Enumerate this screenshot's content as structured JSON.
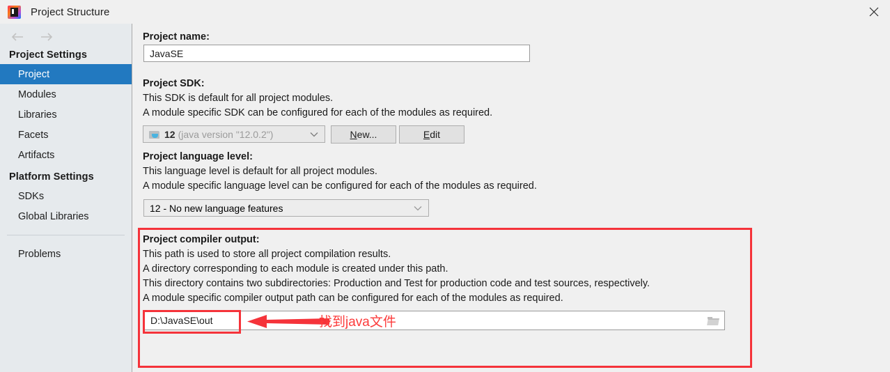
{
  "window": {
    "title": "Project Structure",
    "icon": "intellij-idea-logo",
    "close_label": "✕"
  },
  "sidebar": {
    "nav_back_icon": "arrow-left-icon",
    "nav_forward_icon": "arrow-right-icon",
    "groups": [
      {
        "header": "Project Settings",
        "items": [
          {
            "label": "Project",
            "selected": true
          },
          {
            "label": "Modules",
            "selected": false
          },
          {
            "label": "Libraries",
            "selected": false
          },
          {
            "label": "Facets",
            "selected": false
          },
          {
            "label": "Artifacts",
            "selected": false
          }
        ]
      },
      {
        "header": "Platform Settings",
        "items": [
          {
            "label": "SDKs",
            "selected": false
          },
          {
            "label": "Global Libraries",
            "selected": false
          }
        ]
      }
    ],
    "problems_label": "Problems"
  },
  "main": {
    "project_name": {
      "label": "Project name:",
      "value": "JavaSE"
    },
    "project_sdk": {
      "label": "Project SDK:",
      "desc_line1": "This SDK is default for all project modules.",
      "desc_line2": "A module specific SDK can be configured for each of the modules as required.",
      "selected_version": "12",
      "selected_detail": "(java version \"12.0.2\")",
      "sdk_icon": "java-sdk-folder-icon",
      "chevron_icon": "chevron-down-icon",
      "new_button": "New...",
      "new_button_mnemonic": "N",
      "new_button_rest": "ew...",
      "edit_button": "Edit",
      "edit_button_mnemonic": "E",
      "edit_button_rest": "dit"
    },
    "language_level": {
      "label": "Project language level:",
      "desc_line1": "This language level is default for all project modules.",
      "desc_line2": "A module specific language level can be configured for each of the modules as required.",
      "selected": "12 - No new language features",
      "chevron_icon": "chevron-down-icon"
    },
    "compiler_output": {
      "label": "Project compiler output:",
      "desc_line1": "This path is used to store all project compilation results.",
      "desc_line2": "A directory corresponding to each module is created under this path.",
      "desc_line3": "This directory contains two subdirectories: Production and Test for production code and test sources, respectively.",
      "desc_line4": "A module specific compiler output path can be configured for each of the modules as required.",
      "path_value": "D:\\JavaSE\\out",
      "browse_icon": "folder-browse-icon"
    }
  },
  "annotations": {
    "callout_text": "找到java文件",
    "arrow_icon": "left-arrow-annotation",
    "highlight_color": "#f5333a",
    "text_color": "#fc3b3b"
  }
}
